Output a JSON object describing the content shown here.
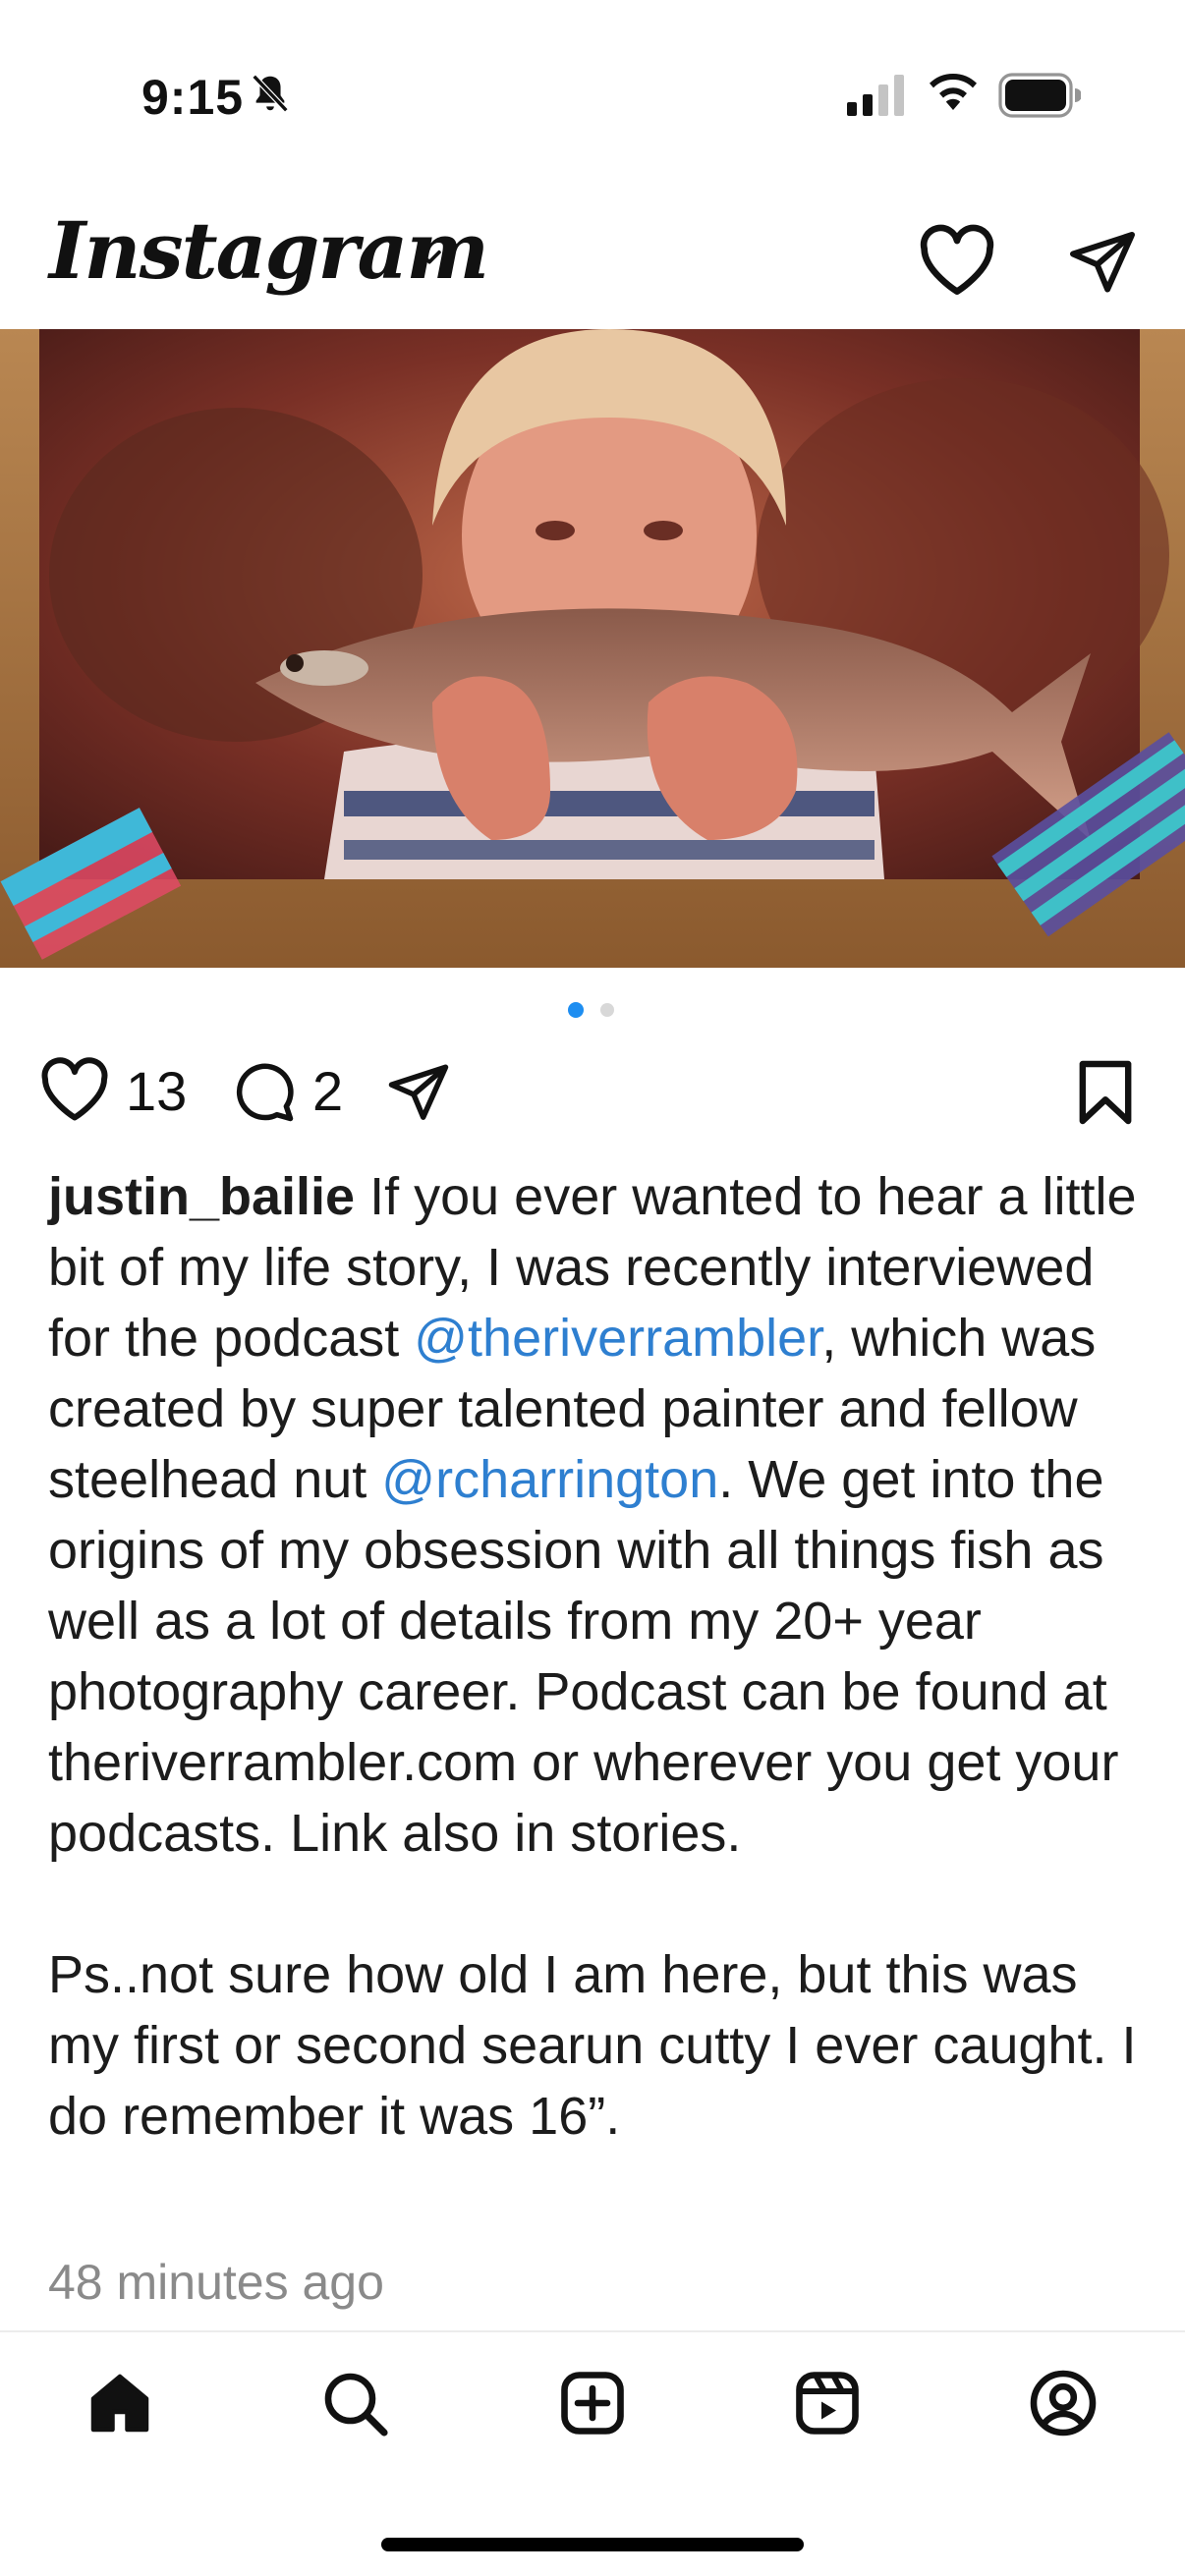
{
  "status_bar": {
    "time": "9:15"
  },
  "header": {
    "logo_text": "Instagram"
  },
  "post": {
    "photo_alt": "Vintage photo of a boy holding a fish",
    "carousel": {
      "current": 1,
      "total": 2
    },
    "like_count": "13",
    "comment_count": "2",
    "username": "justin_bailie",
    "caption": {
      "part1": " If you ever wanted to hear a little bit of my life story, I was recently interviewed for the podcast ",
      "mention1": "@theriverrambler",
      "part2": ", which was created by super talented painter and fellow steelhead nut ",
      "mention2": "@rcharrington",
      "part3": ". We get into the origins of my obsession with all things fish as well as a lot of details from my 20+ year photography career. Podcast can be found at theriverrambler.com or wherever you get your podcasts. Link also in stories.",
      "paragraph2": "Ps..not sure how old I am here, but this was my first or second searun cutty I ever caught. I do remember it was 16”."
    },
    "timestamp": "48 minutes ago"
  },
  "icons": {
    "header": [
      "chevron-down-icon",
      "heart-icon",
      "send-icon"
    ],
    "actions": [
      "like-icon",
      "comment-icon",
      "share-icon",
      "bookmark-icon"
    ],
    "nav": [
      "home-icon",
      "search-icon",
      "create-icon",
      "reels-icon",
      "profile-icon"
    ]
  },
  "colors": {
    "link": "#2e7fd0",
    "carousel_active": "#1e8ef1",
    "timestamp": "#8a8a8a"
  }
}
